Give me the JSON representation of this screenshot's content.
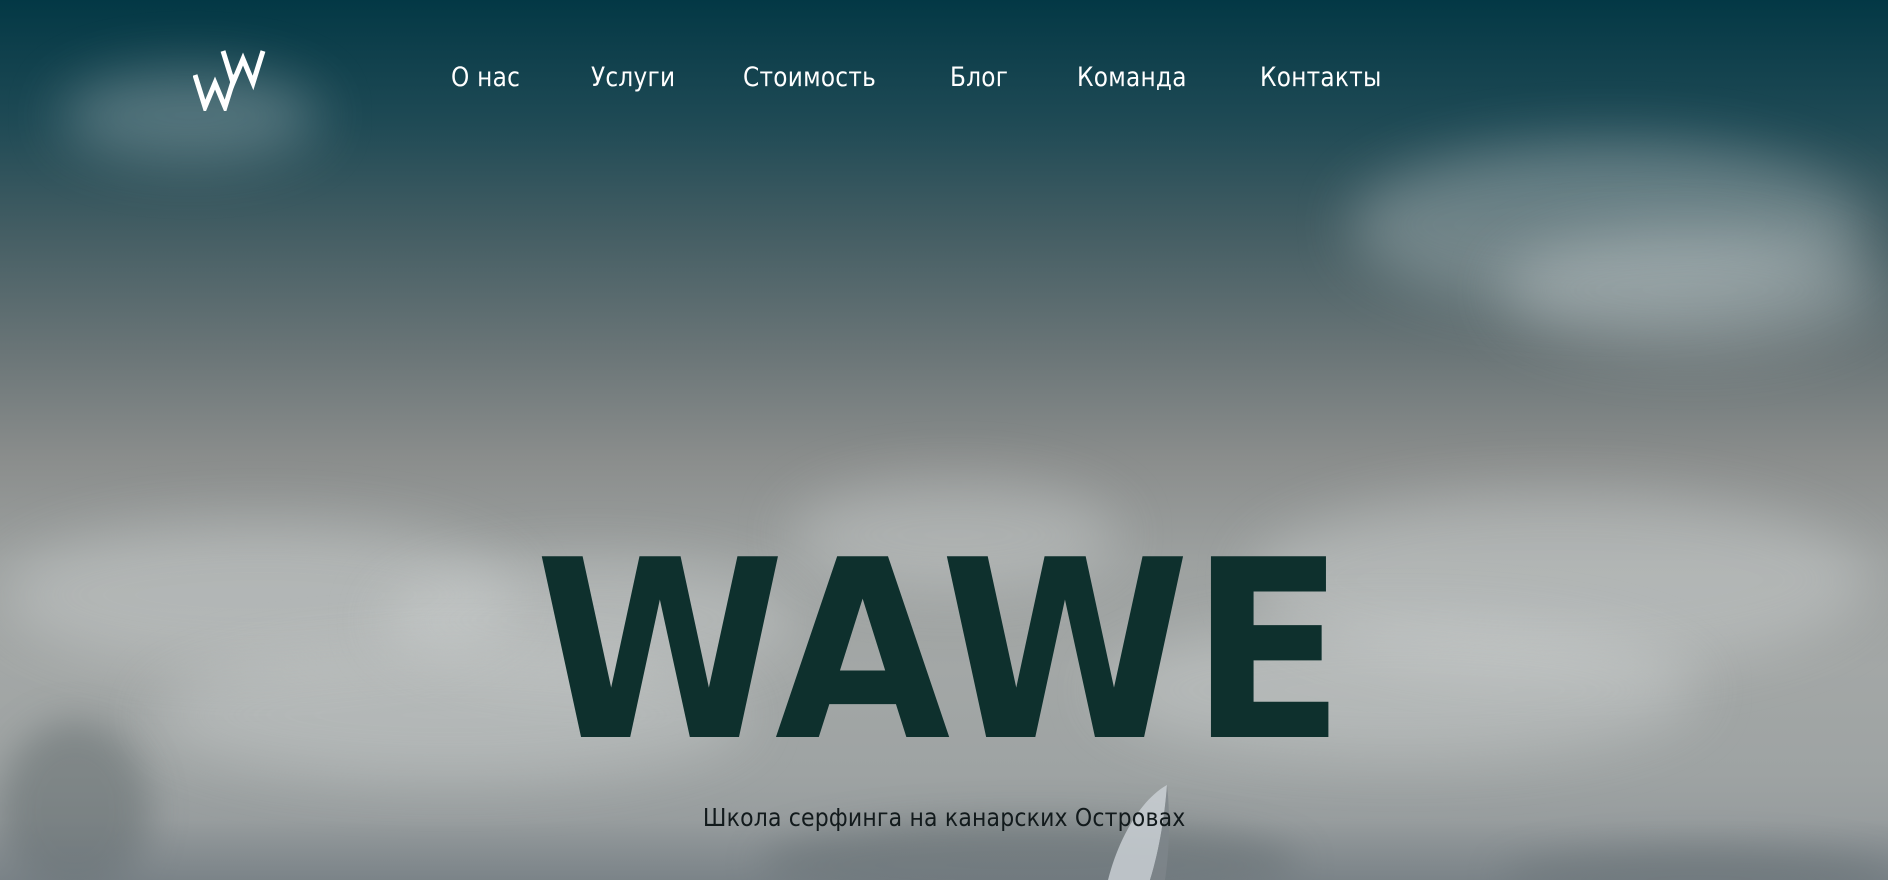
{
  "brand": {
    "logo_icon": "double-w-logo-icon",
    "title": "WAWE",
    "subtitle": "Школа серфинга на канарских Островах"
  },
  "nav": {
    "items": [
      {
        "label": "О нас"
      },
      {
        "label": "Услуги"
      },
      {
        "label": "Стоимость"
      },
      {
        "label": "Блог"
      },
      {
        "label": "Команда"
      },
      {
        "label": "Контакты"
      }
    ]
  },
  "colors": {
    "title": "#0e302d",
    "nav_text": "#ffffff",
    "subtitle_text": "#121a1c",
    "sky_top": "#033845"
  }
}
